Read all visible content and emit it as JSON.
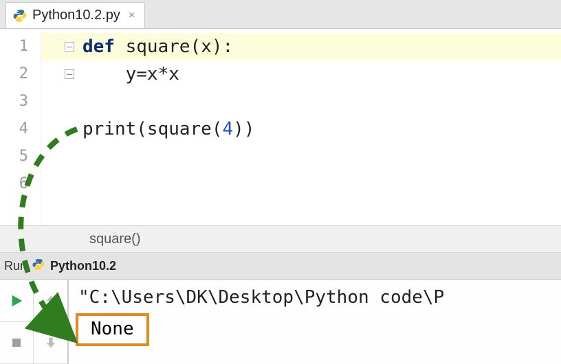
{
  "tab": {
    "filename": "Python10.2.py",
    "close_glyph": "×"
  },
  "editor": {
    "lines": [
      {
        "n": "1",
        "tokens": [
          [
            "kw",
            "def "
          ],
          [
            "fn",
            "square"
          ],
          [
            "txt",
            "(x):"
          ]
        ],
        "active": true,
        "fold": true
      },
      {
        "n": "2",
        "tokens": [
          [
            "txt",
            "    y=x*x"
          ]
        ],
        "fold": true
      },
      {
        "n": "3",
        "tokens": []
      },
      {
        "n": "4",
        "tokens": [
          [
            "txt",
            "print(square("
          ],
          [
            "num",
            "4"
          ],
          [
            "txt",
            "))"
          ]
        ]
      },
      {
        "n": "5",
        "tokens": []
      },
      {
        "n": "6",
        "tokens": []
      }
    ]
  },
  "structure": {
    "breadcrumb": "square()"
  },
  "run_panel": {
    "label": "Run",
    "config_name": "Python10.2"
  },
  "console": {
    "path_line": "\"C:\\Users\\DK\\Desktop\\Python code\\P",
    "output": "None"
  }
}
